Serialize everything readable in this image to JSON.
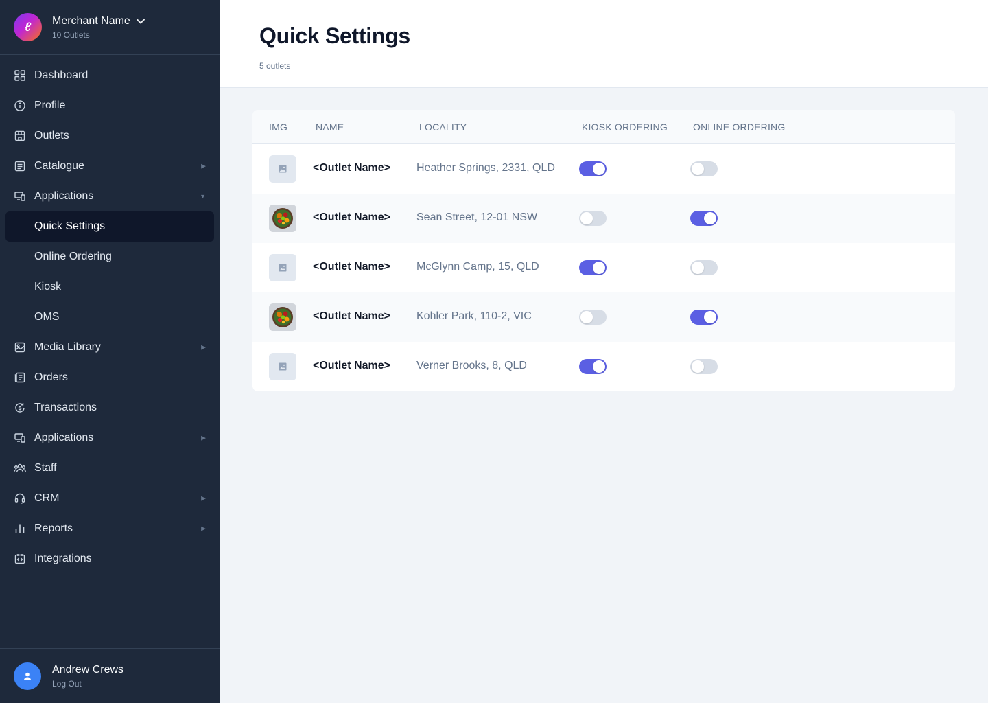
{
  "merchant": {
    "name": "Merchant Name",
    "outlets": "10 Outlets",
    "logo_letter": "ℓ"
  },
  "nav": {
    "dashboard": "Dashboard",
    "profile": "Profile",
    "outlets": "Outlets",
    "catalogue": "Catalogue",
    "applications": "Applications",
    "sub": {
      "quick_settings": "Quick Settings",
      "online_ordering": "Online Ordering",
      "kiosk": "Kiosk",
      "oms": "OMS"
    },
    "media_library": "Media Library",
    "orders": "Orders",
    "transactions": "Transactions",
    "applications2": "Applications",
    "staff": "Staff",
    "crm": "CRM",
    "reports": "Reports",
    "integrations": "Integrations"
  },
  "user": {
    "name": "Andrew Crews",
    "logout": "Log Out"
  },
  "page": {
    "title": "Quick Settings",
    "subtitle": "5 outlets"
  },
  "table": {
    "columns": {
      "img": "IMG",
      "name": "NAME",
      "locality": "LOCALITY",
      "kiosk": "KIOSK ORDERING",
      "online": "ONLINE ORDERING"
    },
    "rows": [
      {
        "name": "<Outlet Name>",
        "locality": "Heather Springs, 2331, QLD",
        "image": "placeholder",
        "kiosk": true,
        "online": false
      },
      {
        "name": "<Outlet Name>",
        "locality": "Sean Street, 12-01 NSW",
        "image": "food-bowl",
        "kiosk": false,
        "online": true
      },
      {
        "name": "<Outlet Name>",
        "locality": "McGlynn Camp, 15, QLD",
        "image": "placeholder",
        "kiosk": true,
        "online": false
      },
      {
        "name": "<Outlet Name>",
        "locality": "Kohler Park, 110-2, VIC",
        "image": "food-bowl",
        "kiosk": false,
        "online": true
      },
      {
        "name": "<Outlet Name>",
        "locality": "Verner Brooks, 8, QLD",
        "image": "placeholder",
        "kiosk": true,
        "online": false
      }
    ]
  },
  "colors": {
    "sidebar": "#1e293b",
    "accent": "#5b5fe3",
    "active_item": "#0f172a"
  }
}
